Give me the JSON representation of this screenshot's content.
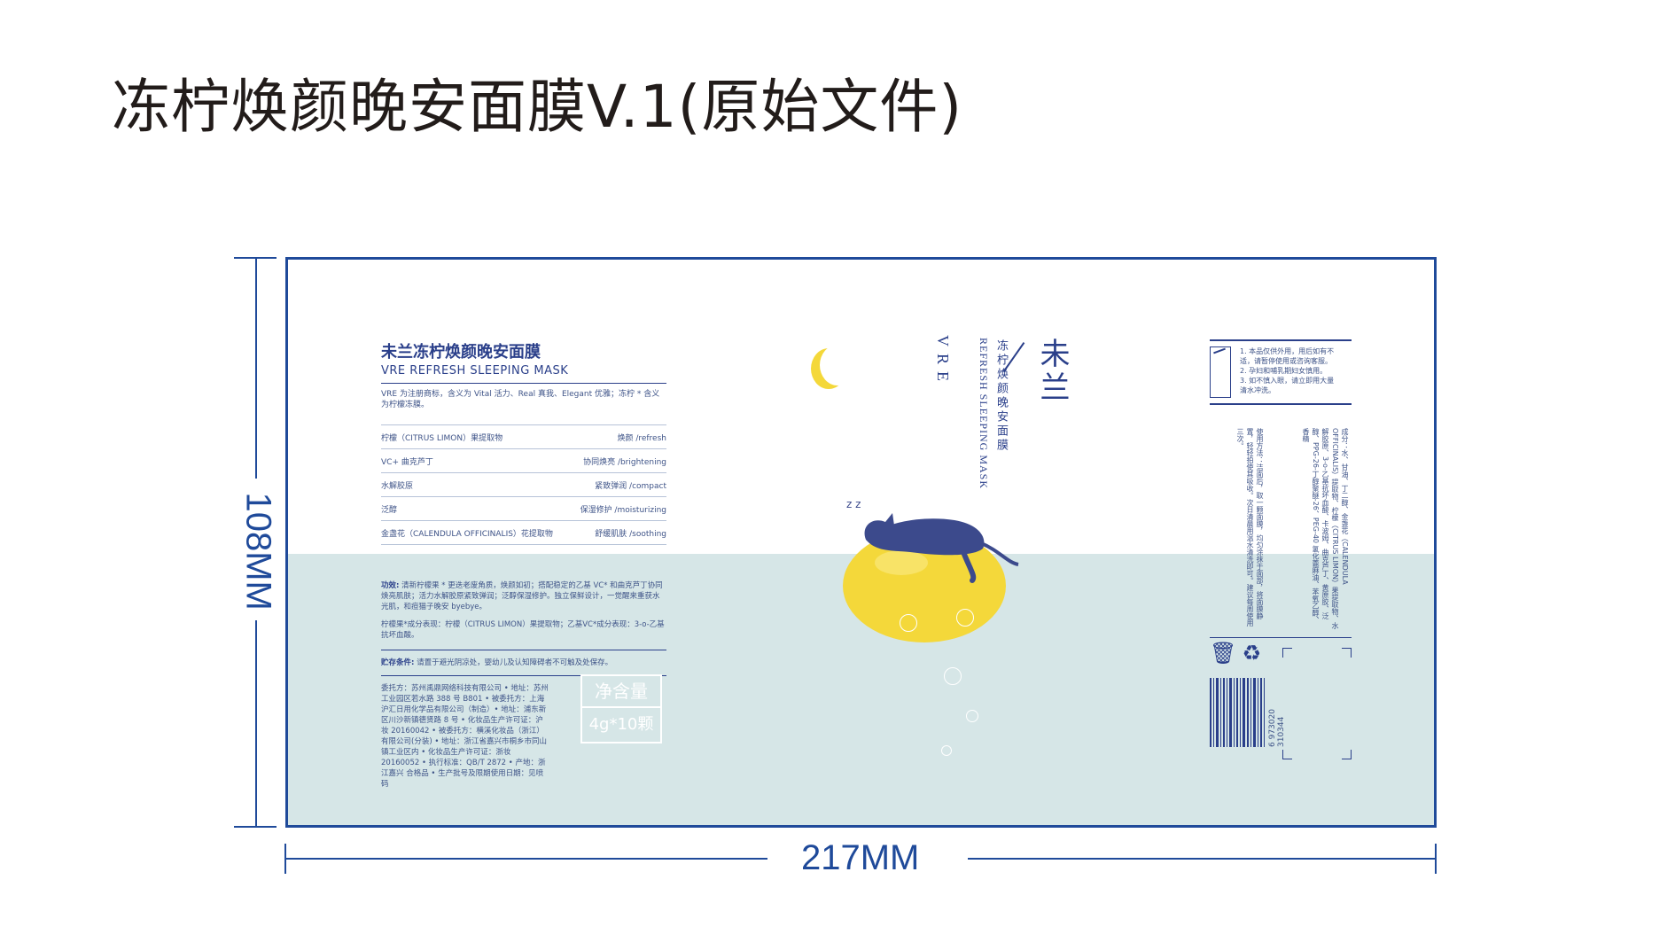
{
  "page_title": "冻柠焕颜晚安面膜V.1(原始文件)",
  "dimensions": {
    "height_label": "108MM",
    "width_label": "217MM"
  },
  "colors": {
    "accent": "#1f4a9a",
    "navy": "#2a3f8a",
    "lemon": "#f4d83a",
    "water": "#d6e6e7"
  },
  "left_panel": {
    "title": "未兰冻柠焕颜晚安面膜",
    "subtitle": "VRE REFRESH SLEEPING MASK",
    "intro": "VRE 为注册商标，含义为 Vital 活力、Real 真我、Elegant 优雅；冻柠 * 含义为柠檬冻膜。",
    "ingredients": [
      {
        "name": "柠檬（CITRUS LIMON）果提取物",
        "effect": "焕颜 /refresh"
      },
      {
        "name": "VC+ 曲克芦丁",
        "effect": "协同焕亮 /brightening"
      },
      {
        "name": "水解胶原",
        "effect": "紧致弹润 /compact"
      },
      {
        "name": "泛醇",
        "effect": "保湿修护 /moisturizing"
      },
      {
        "name": "金盏花（CALENDULA OFFICINALIS）花提取物",
        "effect": "舒缓肌肤 /soothing"
      }
    ],
    "function_label": "功效:",
    "function_text": "清新柠檬果 * 更迭老废角质，焕颜如初；搭配稳定的乙基 VC* 和曲克芦丁协同焕亮肌肤；活力水解胶原紧致弹润；泛醇保湿修护。独立保鲜设计，一觉醒来重获水光肌，和痘猫子晚安 byebye。",
    "component_text": "柠檬果*成分表现：柠檬（CITRUS LIMON）果提取物；乙基VC*成分表现：3-o-乙基抗坏血酸。",
    "storage_label": "贮存条件:",
    "storage_text": "请置于避光阴凉处，婴幼儿及认知障碍者不可触及处保存。",
    "company_text": "委托方：苏州禹鼎网络科技有限公司 • 地址：苏州工业园区若水路 388 号 B801 • 被委托方：上海沪汇日用化学品有限公司（制造）• 地址：浦东新区川沙新镇德贤路 8 号 • 化妆品生产许可证：沪妆 20160042 • 被委托方：横溪化妆品（浙江）有限公司(分装) • 地址：浙江省嘉兴市桐乡市同山镇工业区内 • 化妆品生产许可证：浙妆 20160052 • 执行标准：QB/T 2872 • 产地：浙江嘉兴 合格品 • 生产批号及限期使用日期：见喷码",
    "net_label": "净含量",
    "net_value": "4g*10颗"
  },
  "center": {
    "vre": "VRE",
    "english": "REFRESH SLEEPING MASK",
    "chinese": "冻柠焕颜晚安面膜",
    "brand": "未兰",
    "sleep_z": "z z"
  },
  "right_panel": {
    "warnings": [
      "1. 本品仅供外用，用后如有不",
      "适，请暂停使用或咨询客服。",
      "2. 孕妇和哺乳期妇女慎用。",
      "3. 如不慎入眼，请立即用大量",
      "清水冲洗。"
    ],
    "usage": "使用方法：洁面后，取一颗面膜，均匀涂抹于面部，将面膜静置，轻轻拍使其吸收。次日清晨用温水清洗即可。建议每周使用三次。",
    "components": "成分：水、甘油、丁二醇、金盏花（CALENDULA OFFICINALIS）提取物、柠檬（CITRUS LIMON）果提取物、水解胶原、3-o-乙基抗坏血酸、卡波姆、曲克芦丁、黄原胶、泛醇、PPG-26-丁醇聚醚-26、PEG-40 氢化蓖麻油、苯氧乙醇、香精",
    "barcode_number": "6 973020 310344"
  }
}
